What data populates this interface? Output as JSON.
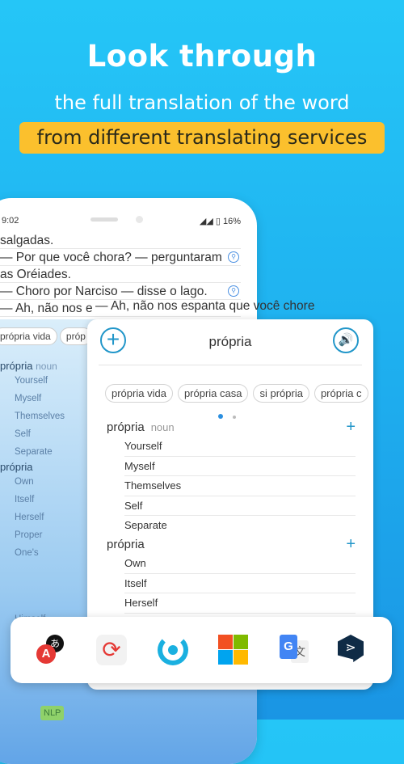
{
  "promo": {
    "title": "Look through",
    "subtitle": "the full translation of the word",
    "highlight": "from different translating services",
    "highlight_color": "#fbc02d",
    "background": "#25c6f7"
  },
  "status": {
    "time": "9:02",
    "battery": "16%"
  },
  "book": {
    "lines": [
      "salgadas.",
      "— Por que você chora? — perguntaram",
      "as Oréiades.",
      "— Choro por Narciso — disse o lago.",
      "— Ah, não nos e"
    ],
    "overflow_line": "— Ah, não nos espanta que você chore"
  },
  "background_dict": {
    "chips": [
      "própria vida",
      "próp"
    ],
    "sections": [
      {
        "word": "própria",
        "pos": "noun",
        "translations": [
          "Yourself",
          "Myself",
          "Themselves",
          "Self",
          "Separate"
        ]
      },
      {
        "word": "própria",
        "translations": [
          "Own",
          "Itself",
          "Herself",
          "Proper",
          "One's"
        ]
      }
    ],
    "last": "Himself",
    "dock_label": "NLP"
  },
  "card": {
    "word": "própria",
    "chips": [
      "própria vida",
      "própria casa",
      "si própria",
      "própria c"
    ],
    "page": 1,
    "pages": 2,
    "sections": [
      {
        "word": "própria",
        "pos": "noun",
        "translations": [
          "Yourself",
          "Myself",
          "Themselves",
          "Self",
          "Separate"
        ]
      },
      {
        "word": "própria",
        "translations": [
          "Own",
          "Itself",
          "Herself"
        ]
      }
    ]
  },
  "services": [
    "reverso-icon",
    "abbyy-icon",
    "yandex-icon",
    "microsoft-translator-icon",
    "google-translate-icon",
    "deepl-icon"
  ],
  "service_labels": {
    "abbyy": "A",
    "reverso": "あ"
  }
}
